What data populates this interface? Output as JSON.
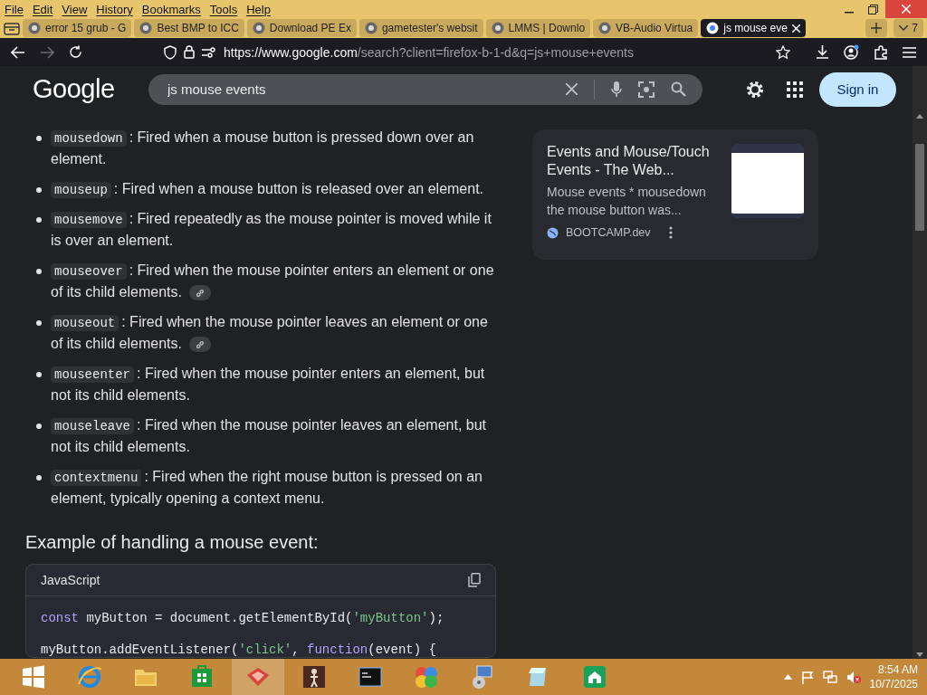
{
  "menu_bar": {
    "items": [
      "File",
      "Edit",
      "View",
      "History",
      "Bookmarks",
      "Tools",
      "Help"
    ]
  },
  "tabs": [
    {
      "title": "error 15 grub - G",
      "selected": false
    },
    {
      "title": "Best BMP to ICC",
      "selected": false
    },
    {
      "title": "Download PE Ex",
      "selected": false
    },
    {
      "title": "gametester's websit",
      "selected": false
    },
    {
      "title": "LMMS | Downlo",
      "selected": false
    },
    {
      "title": "VB-Audio Virtua",
      "selected": false
    },
    {
      "title": "js mouse eve",
      "selected": true
    }
  ],
  "tab_count": "7",
  "address_bar": {
    "url_host": "https://www.google.com",
    "url_path": "/search?client=firefox-b-1-d&q=js+mouse+events"
  },
  "google_header": {
    "logo": "Google",
    "search": {
      "value": "js mouse events"
    },
    "sign_in": "Sign in"
  },
  "events": [
    {
      "term": "mousedown",
      "description": ": Fired when a mouse button is pressed down over an element.",
      "link": false
    },
    {
      "term": "mouseup",
      "description": ": Fired when a mouse button is released over an element.",
      "link": false
    },
    {
      "term": "mousemove",
      "description": ": Fired repeatedly as the mouse pointer is moved while it is over an element.",
      "link": false
    },
    {
      "term": "mouseover",
      "description": ": Fired when the mouse pointer enters an element or one of its child elements.",
      "link": true
    },
    {
      "term": "mouseout",
      "description": ": Fired when the mouse pointer leaves an element or one of its child elements.",
      "link": true
    },
    {
      "term": "mouseenter",
      "description": ": Fired when the mouse pointer enters an element, but not its child elements.",
      "link": false
    },
    {
      "term": "mouseleave",
      "description": ": Fired when the mouse pointer leaves an element, but not its child elements.",
      "link": false
    },
    {
      "term": "contextmenu",
      "description": ": Fired when the right mouse button is pressed on an element, typically opening a context menu.",
      "link": false
    }
  ],
  "heading": "Example of handling a mouse event:",
  "code": {
    "language": "JavaScript",
    "lines": [
      [
        {
          "kind": "keyword",
          "text": "const"
        },
        {
          "kind": "plain",
          "text": " myButton = document.getElementById("
        },
        {
          "kind": "string",
          "text": "'myButton'"
        },
        {
          "kind": "plain",
          "text": ");"
        }
      ],
      [
        {
          "kind": "plain",
          "text": "myButton.addEventListener("
        },
        {
          "kind": "string",
          "text": "'click'"
        },
        {
          "kind": "plain",
          "text": ", "
        },
        {
          "kind": "keyword",
          "text": "function"
        },
        {
          "kind": "plain",
          "text": "(event) {"
        }
      ]
    ]
  },
  "result_card": {
    "title": "Events and Mouse/Touch Events - The Web...",
    "snippet": "Mouse events * mousedown the mouse button was...",
    "site": "BOOTCAMP.dev"
  },
  "taskbar": {
    "time": "8:54 AM",
    "date": "10/7/2025"
  }
}
